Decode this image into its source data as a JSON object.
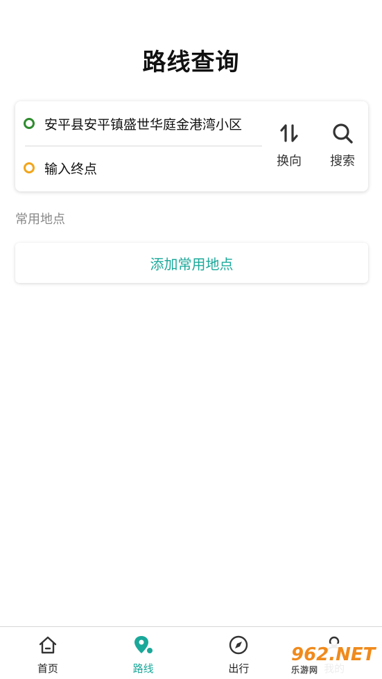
{
  "page": {
    "title": "路线查询"
  },
  "route": {
    "start": "安平县安平镇盛世华庭金港湾小区",
    "end_placeholder": "输入终点",
    "swap_label": "换向",
    "search_label": "搜索"
  },
  "favorites": {
    "section_label": "常用地点",
    "add_label": "添加常用地点"
  },
  "tabbar": {
    "items": [
      {
        "label": "首页",
        "icon": "home-icon",
        "active": false
      },
      {
        "label": "路线",
        "icon": "route-pin-icon",
        "active": true
      },
      {
        "label": "出行",
        "icon": "compass-icon",
        "active": false
      },
      {
        "label": "我的",
        "icon": "user-icon",
        "active": false
      }
    ]
  },
  "watermark": {
    "brand": "962.NET",
    "sub": "乐游网"
  },
  "colors": {
    "accent": "#1aa89a",
    "start_dot": "#2e8b2e",
    "end_dot": "#f2a51a",
    "watermark_orange": "#f08a1c"
  }
}
